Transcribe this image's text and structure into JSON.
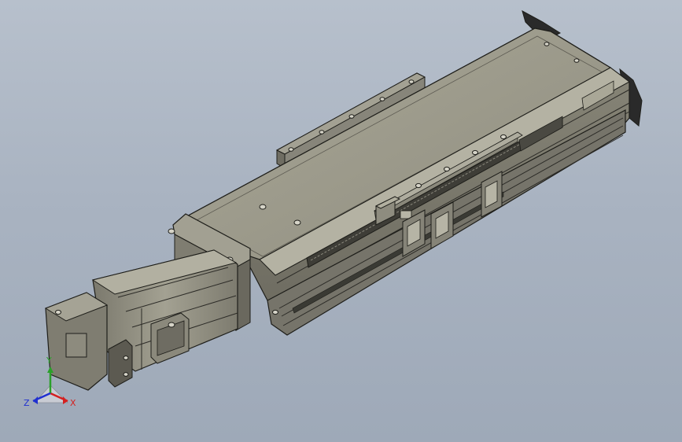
{
  "viewport": {
    "model": "linear-actuator-module",
    "view": "isometric",
    "display_style": "shaded-with-edges",
    "colors": {
      "background_top": "#b7c0cc",
      "background_bottom": "#9ea9b8",
      "body": "#8e8c7e",
      "body_light": "#a7a596",
      "body_dark": "#5e5d54",
      "edge": "#1e1e1a",
      "rail_dark": "#3a3a34",
      "fan_blade": "#2a2a2a"
    }
  },
  "triad": {
    "x_label": "X",
    "y_label": "Y",
    "z_label": "Z",
    "x_color": "#d42020",
    "y_color": "#2aa02a",
    "z_color": "#2030d0"
  }
}
